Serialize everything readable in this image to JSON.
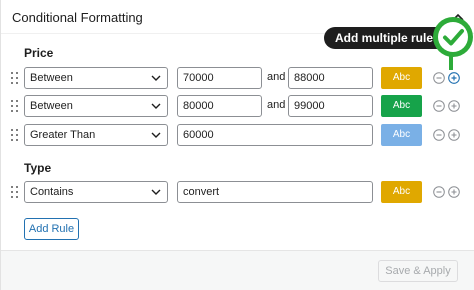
{
  "panel": {
    "title": "Conditional Formatting"
  },
  "sections": {
    "price": {
      "label": "Price",
      "rules": [
        {
          "operator": "Between",
          "value1": "70000",
          "and": "and",
          "value2": "88000",
          "preview": "Abc",
          "color": "#e0a800"
        },
        {
          "operator": "Between",
          "value1": "80000",
          "and": "and",
          "value2": "99000",
          "preview": "Abc",
          "color": "#16a34a"
        },
        {
          "operator": "Greater Than",
          "value1": "60000",
          "preview": "Abc",
          "color": "#7ab0e6"
        }
      ]
    },
    "type": {
      "label": "Type",
      "rules": [
        {
          "operator": "Contains",
          "value1": "convert",
          "preview": "Abc",
          "color": "#e0a800"
        }
      ]
    }
  },
  "buttons": {
    "add_rule": "Add Rule",
    "save_apply": "Save & Apply"
  },
  "tooltip": {
    "text": "Add multiple rules"
  },
  "icons": {
    "drag": "drag-handle-icon",
    "remove": "minus-circle-icon",
    "add": "plus-circle-icon",
    "dropdown": "chevron-down-icon",
    "check": "check-badge-icon"
  },
  "colors": {
    "accent": "#2271b1",
    "badge_green": "#2dab39"
  }
}
